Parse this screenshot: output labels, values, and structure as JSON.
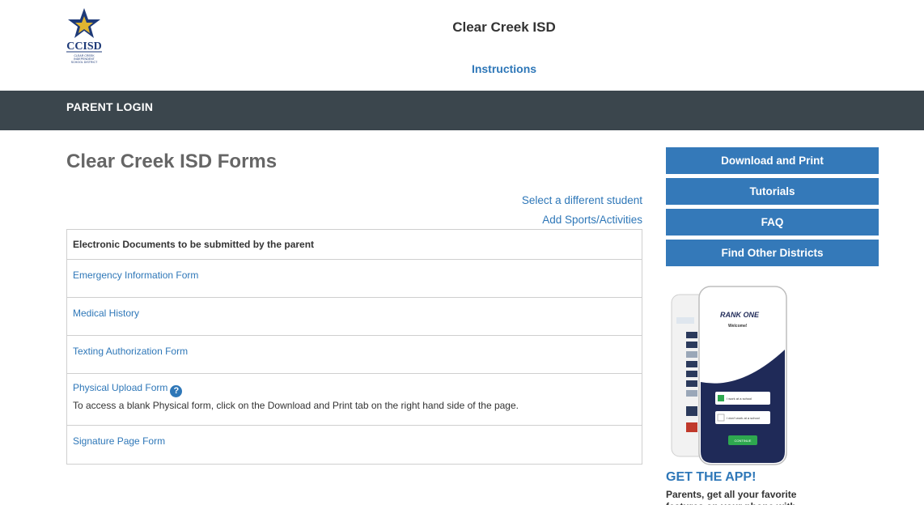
{
  "header": {
    "logo_text": "CCISD",
    "logo_subtext": "CLEAR CREEK INDEPENDENT SCHOOL DISTRICT",
    "site_title": "Clear Creek ISD",
    "instructions_label": "Instructions"
  },
  "nav": {
    "parent_login_label": "PARENT LOGIN"
  },
  "main": {
    "page_title": "Clear Creek ISD Forms",
    "select_student_label": "Select a different student",
    "add_sports_label": "Add Sports/Activities",
    "forms_heading": "Electronic Documents to be submitted by the parent",
    "forms": [
      {
        "label": "Emergency Information Form"
      },
      {
        "label": "Medical History"
      },
      {
        "label": "Texting Authorization Form"
      },
      {
        "label": "Physical Upload Form",
        "note": "To access a blank Physical form, click on the Download and Print tab on the right hand side of the page."
      },
      {
        "label": "Signature Page Form"
      }
    ]
  },
  "sidebar": {
    "buttons": [
      "Download and Print",
      "Tutorials",
      "FAQ",
      "Find Other Districts"
    ],
    "app_brand": "RANK ONE",
    "app_welcome": "Welcome!",
    "app_option_1": "I work at a school",
    "app_option_2": "I don't work at a school",
    "app_continue": "CONTINUE",
    "get_app_label": "GET THE APP!",
    "promo_text": "Parents, get all your favorite features on your phone with the"
  },
  "colors": {
    "nav_bg": "#3b464d",
    "accent": "#3479b9",
    "link": "#2e77b8"
  }
}
